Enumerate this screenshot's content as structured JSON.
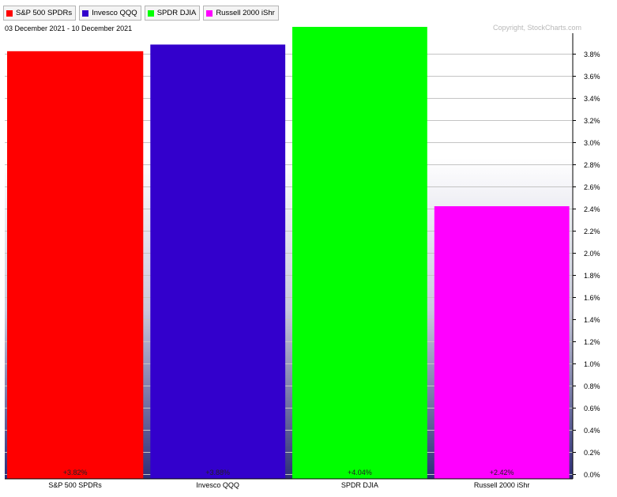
{
  "date_range": "03 December 2021 - 10 December 2021",
  "copyright": "Copyright, StockCharts.com",
  "legend": [
    {
      "label": "S&P 500 SPDRs",
      "color": "#ff0000"
    },
    {
      "label": "Invesco QQQ",
      "color": "#3300cc"
    },
    {
      "label": "SPDR DJIA",
      "color": "#00ff00"
    },
    {
      "label": "Russell 2000 iShr",
      "color": "#ff00ff"
    }
  ],
  "chart_data": {
    "type": "bar",
    "categories": [
      "S&P 500 SPDRs",
      "Invesco QQQ",
      "SPDR DJIA",
      "Russell 2000 iShr"
    ],
    "values": [
      3.82,
      3.88,
      4.04,
      2.42
    ],
    "value_labels": [
      "+3.82%",
      "+3.88%",
      "+4.04%",
      "+2.42%"
    ],
    "colors": [
      "#ff0000",
      "#3300cc",
      "#00ff00",
      "#ff00ff"
    ],
    "y_ticks": [
      "0.0%",
      "0.2%",
      "0.4%",
      "0.6%",
      "0.8%",
      "1.0%",
      "1.2%",
      "1.4%",
      "1.6%",
      "1.8%",
      "2.0%",
      "2.2%",
      "2.4%",
      "2.6%",
      "2.8%",
      "3.0%",
      "3.2%",
      "3.4%",
      "3.6%",
      "3.8%"
    ],
    "y_tick_values": [
      0,
      0.2,
      0.4,
      0.6,
      0.8,
      1.0,
      1.2,
      1.4,
      1.6,
      1.8,
      2.0,
      2.2,
      2.4,
      2.6,
      2.8,
      3.0,
      3.2,
      3.4,
      3.6,
      3.8
    ],
    "ylim": [
      0,
      4.04
    ],
    "y_axis_position": "right",
    "grid": true
  }
}
